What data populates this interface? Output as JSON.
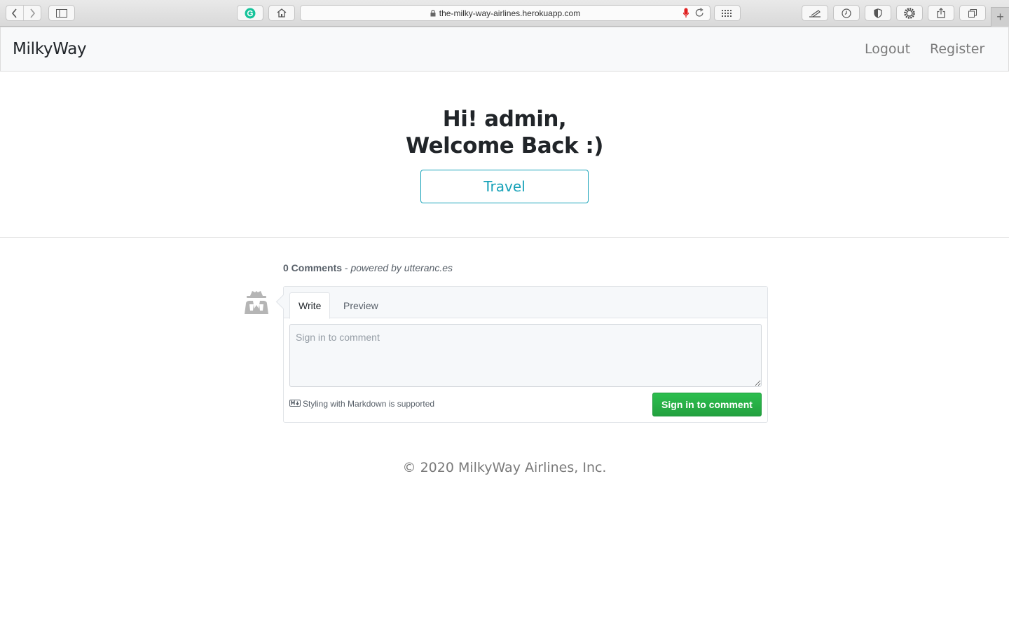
{
  "browser": {
    "url": "the-milky-way-airlines.herokuapp.com",
    "new_tab": "+"
  },
  "navbar": {
    "brand": "MilkyWay",
    "links": [
      {
        "label": "Logout"
      },
      {
        "label": "Register"
      }
    ]
  },
  "hero": {
    "greeting_line1": "Hi! admin,",
    "greeting_line2": "Welcome Back :)",
    "travel_button": "Travel"
  },
  "comments": {
    "count_label": "0 Comments",
    "separator": " - ",
    "powered_by": "powered by utteranc.es",
    "tabs": [
      {
        "label": "Write",
        "active": true
      },
      {
        "label": "Preview",
        "active": false
      }
    ],
    "textarea_placeholder": "Sign in to comment",
    "markdown_note": "Styling with Markdown is supported",
    "signin_button": "Sign in to comment"
  },
  "footer": {
    "copyright": "© 2020 MilkyWay Airlines, Inc."
  },
  "colors": {
    "accent": "#17a2b8",
    "signin_green": "#2cbe4e",
    "navbar_bg": "#f8f9fa"
  }
}
